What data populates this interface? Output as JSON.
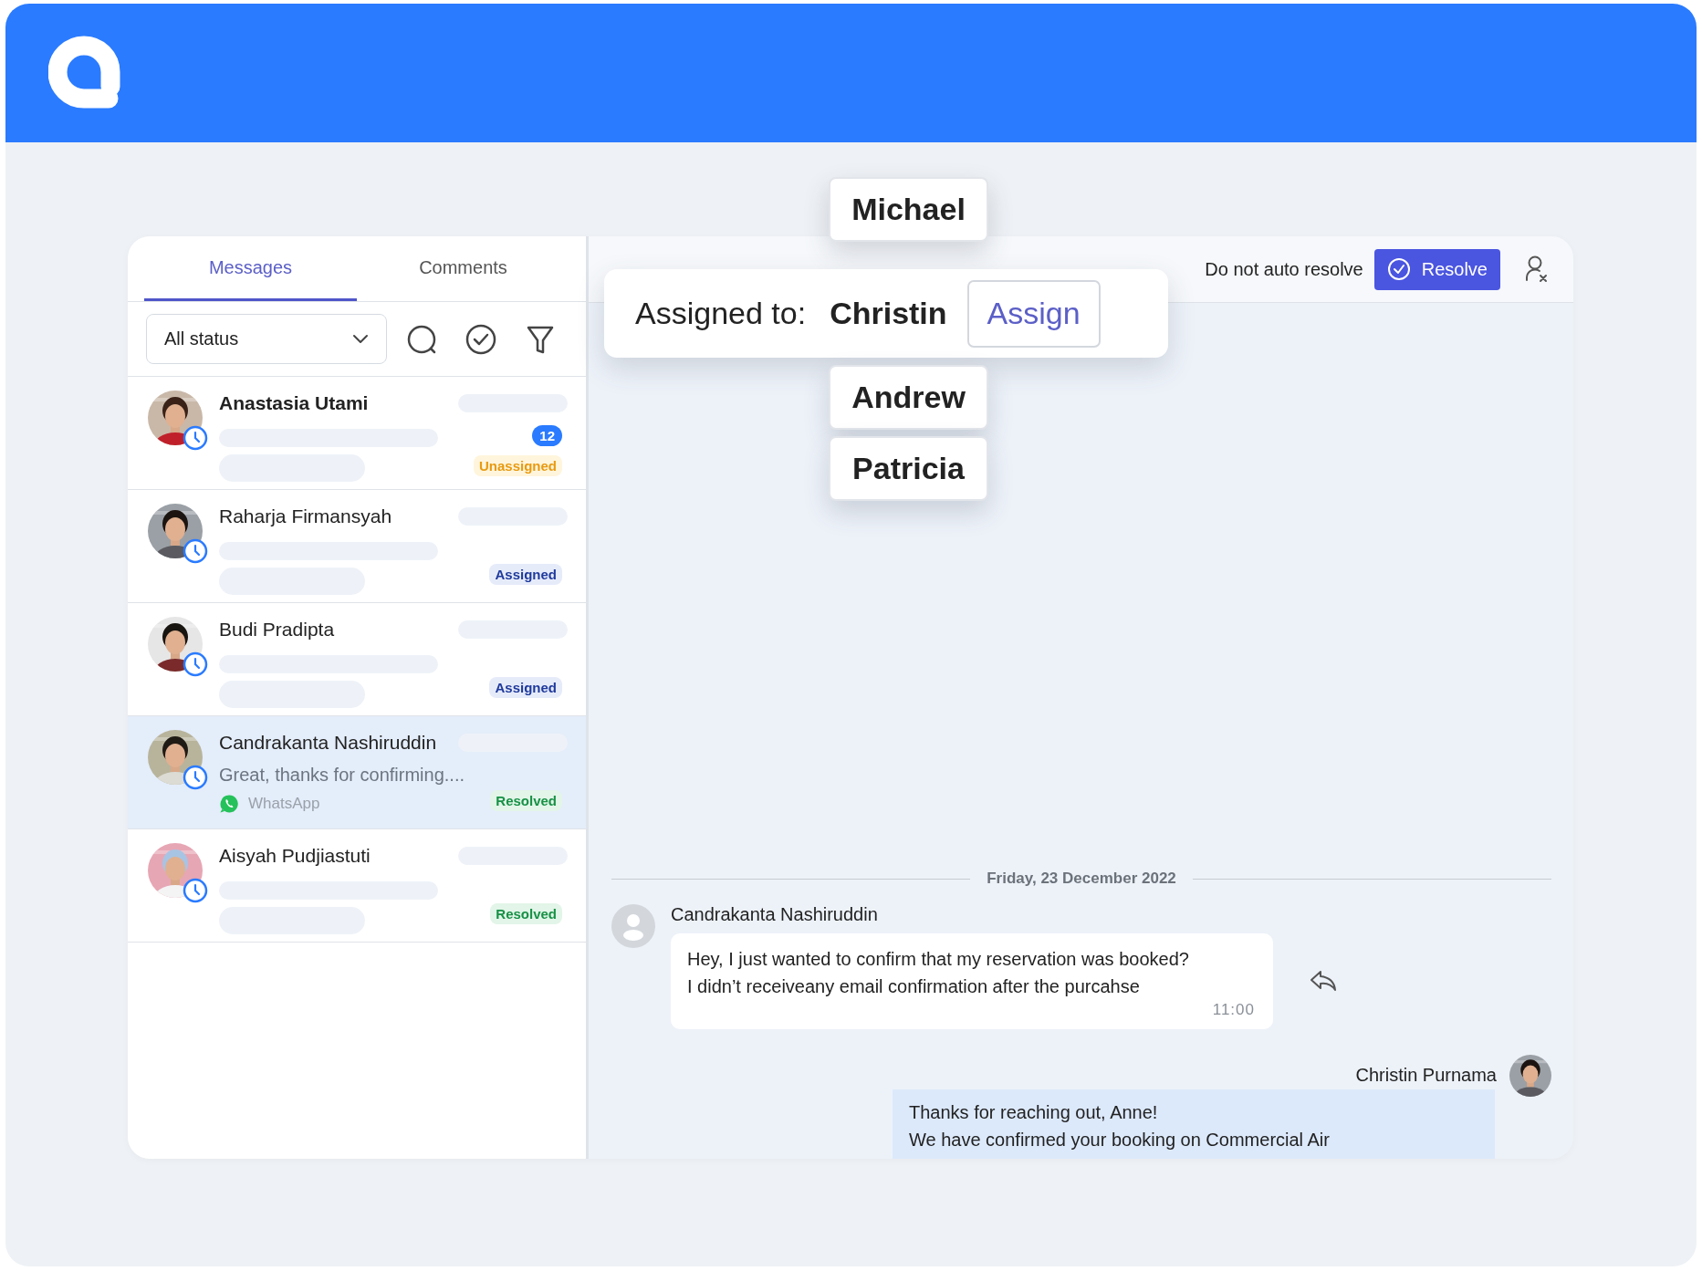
{
  "tabs": [
    {
      "label": "Messages",
      "selected": true
    },
    {
      "label": "Comments",
      "selected": false
    }
  ],
  "status_filter": {
    "value": "All status"
  },
  "conversations": [
    {
      "name": "Anastasia Utami",
      "unread": true,
      "unread_count": "12",
      "status": {
        "label": "Unassigned",
        "kind": "unassigned"
      },
      "selected": false
    },
    {
      "name": "Raharja Firmansyah",
      "unread": false,
      "status": {
        "label": "Assigned",
        "kind": "assigned"
      },
      "selected": false
    },
    {
      "name": "Budi Pradipta",
      "unread": false,
      "status": {
        "label": "Assigned",
        "kind": "assigned"
      },
      "selected": false
    },
    {
      "name": "Candrakanta Nashiruddin",
      "unread": false,
      "preview": "Great, thanks for confirming....",
      "channel": "WhatsApp",
      "status": {
        "label": "Resolved",
        "kind": "resolved"
      },
      "selected": true
    },
    {
      "name": "Aisyah Pudjiastuti",
      "unread": false,
      "status": {
        "label": "Resolved",
        "kind": "resolved"
      },
      "selected": false
    }
  ],
  "chat_header": {
    "auto_resolve_label": "Do not auto resolve",
    "resolve_button": "Resolve"
  },
  "assign_popup": {
    "label": "Assigned to:",
    "assignee": "Christin",
    "button": "Assign"
  },
  "agent_options_above": [
    "Michael"
  ],
  "agent_options_below": [
    "Andrew",
    "Patricia"
  ],
  "chat": {
    "date": "Friday, 23 December 2022",
    "messages": [
      {
        "kind": "incoming",
        "sender": "Candrakanta Nashiruddin",
        "text": "Hey, I just wanted to confirm that my reservation was booked?\nI didn’t receiveany email confirmation after the purcahse",
        "time": "11:00"
      },
      {
        "kind": "outgoing",
        "sender": "Christin Purnama",
        "text": "Thanks for reaching out, Anne!\nWe have confirmed your booking on Commercial Air"
      }
    ]
  }
}
